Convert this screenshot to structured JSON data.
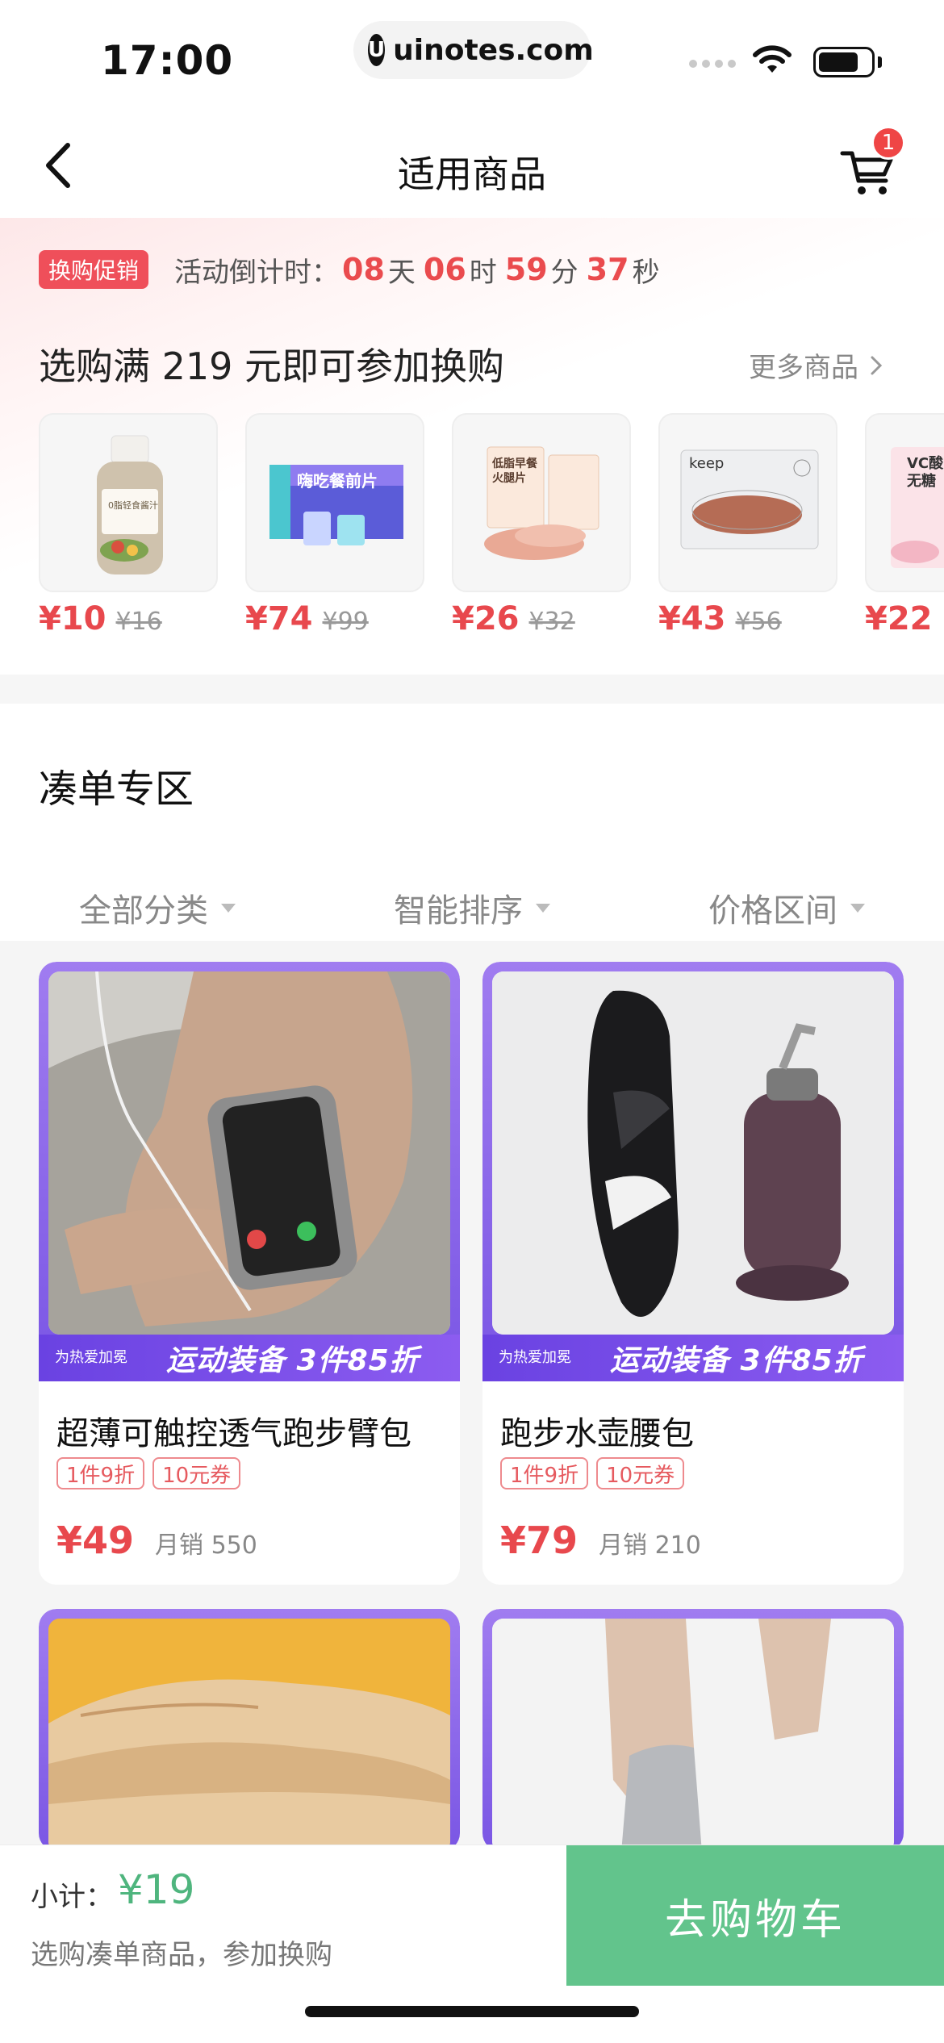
{
  "status_bar": {
    "time": "17:00",
    "url": "uinotes.com",
    "url_logo": "U"
  },
  "nav": {
    "title": "适用商品",
    "cart_badge": "1"
  },
  "promo": {
    "tag": "换购促销",
    "countdown_label": "活动倒计时：",
    "countdown": {
      "days": "08",
      "days_unit": "天",
      "hours": "06",
      "hours_unit": "时",
      "minutes": "59",
      "minutes_unit": "分",
      "seconds": "37",
      "seconds_unit": "秒"
    },
    "headline": "选购满 219 元即可参加换购",
    "more": "更多商品",
    "items": [
      {
        "price": "¥10",
        "original": "¥16",
        "thumb_text": "0脂轻食酱汁"
      },
      {
        "price": "¥74",
        "original": "¥99",
        "thumb_text": "嗨吃餐前片"
      },
      {
        "price": "¥26",
        "original": "¥32",
        "thumb_text": "低脂早餐火腿片"
      },
      {
        "price": "¥43",
        "original": "¥56",
        "thumb_text": "keep"
      },
      {
        "price": "¥22",
        "original": "",
        "thumb_text": "VC酸 无糖"
      }
    ]
  },
  "bundle": {
    "title": "凑单专区",
    "filters": [
      "全部分类",
      "智能排序",
      "价格区间"
    ],
    "banner_logo": "为热爱加冕",
    "banner_text": "运动装备 3件85折",
    "products": [
      {
        "name": "超薄可触控透气跑步臂包",
        "tags": [
          "1件9折",
          "10元券"
        ],
        "price": "¥49",
        "sales": "月销 550"
      },
      {
        "name": "跑步水壶腰包",
        "tags": [
          "1件9折",
          "10元券"
        ],
        "price": "¥79",
        "sales": "月销 210"
      }
    ]
  },
  "footer": {
    "subtotal_label": "小计：",
    "subtotal_value": "¥19",
    "note": "选购凑单商品，参加换购",
    "cta": "去购物车"
  },
  "colors": {
    "accent_red": "#e8484d",
    "accent_green": "#62c48c",
    "banner_purple": "#7a56e4"
  }
}
